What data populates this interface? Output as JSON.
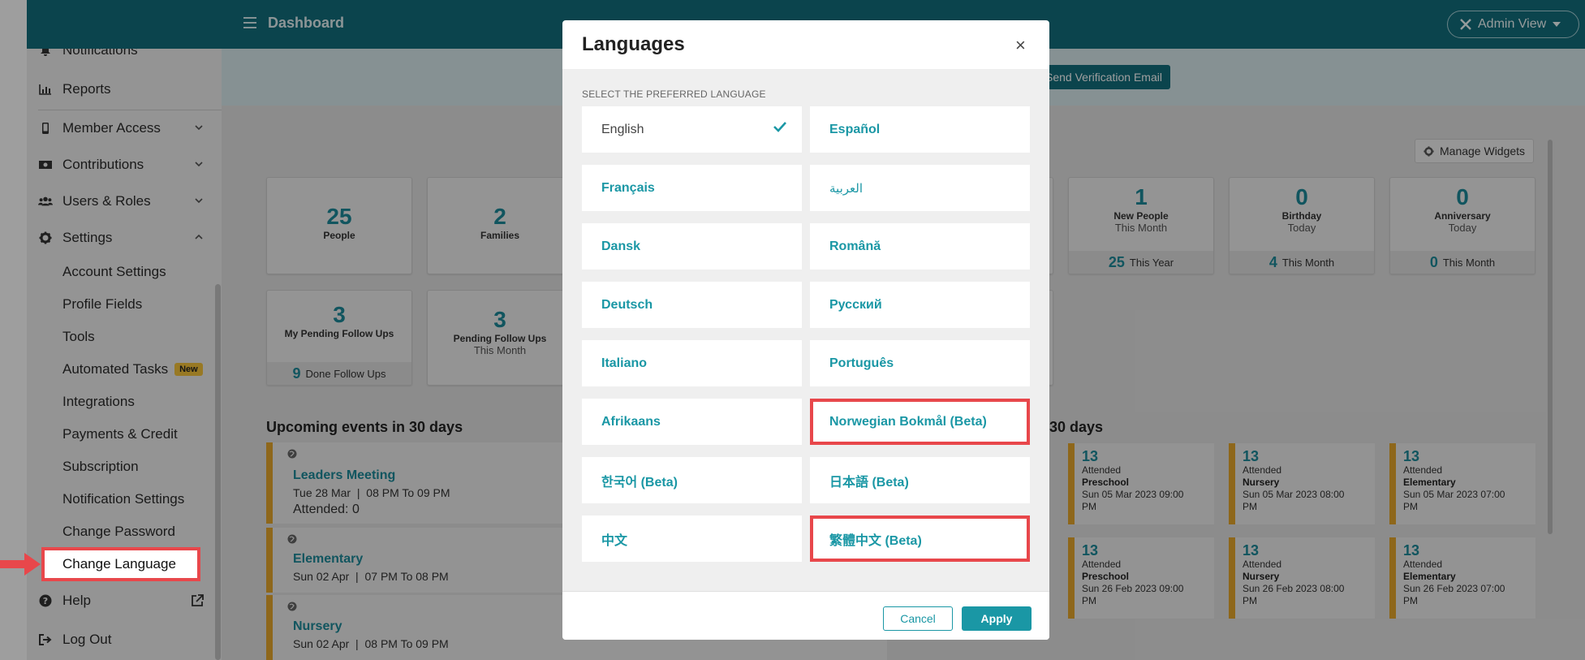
{
  "header": {
    "title": "Dashboard",
    "admin_view": "Admin View"
  },
  "sidebar": {
    "notifications": "Notifications",
    "reports": "Reports",
    "member_access": "Member Access",
    "contributions": "Contributions",
    "users_roles": "Users & Roles",
    "settings": "Settings",
    "settings_items": [
      "Account Settings",
      "Profile Fields",
      "Tools",
      "Automated Tasks",
      "Integrations",
      "Payments & Credit",
      "Subscription",
      "Notification Settings",
      "Change Password",
      "Change Language"
    ],
    "new_badge": "New",
    "help": "Help",
    "logout": "Log Out"
  },
  "main": {
    "verify_button": "Send Verification Email",
    "manage_widgets": "Manage Widgets",
    "stats_row1": [
      {
        "num": "25",
        "label": "People"
      },
      {
        "num": "2",
        "label": "Families"
      },
      {
        "num": "1",
        "label": "New People",
        "sub": "This Month",
        "foot_num": "25",
        "foot_text": "This Year"
      },
      {
        "num": "0",
        "label": "Birthday",
        "sub": "Today",
        "foot_num": "4",
        "foot_text": "This Month"
      },
      {
        "num": "0",
        "label": "Anniversary",
        "sub": "Today",
        "foot_num": "0",
        "foot_text": "This Month"
      }
    ],
    "stats_row2": [
      {
        "num": "3",
        "label": "My Pending Follow Ups",
        "foot_num": "9",
        "foot_text": "Done Follow Ups"
      },
      {
        "num": "3",
        "label": "Pending Follow Ups",
        "sub": "This Month"
      }
    ],
    "events_title": "Upcoming events in 30 days",
    "events": [
      {
        "name": "Leaders Meeting",
        "date": "Tue 28 Mar",
        "time": "08 PM To 09 PM",
        "attended": "Attended: 0"
      },
      {
        "name": "Elementary",
        "date": "Sun 02 Apr",
        "time": "07 PM To 08 PM"
      },
      {
        "name": "Nursery",
        "date": "Sun 02 Apr",
        "time": "08 PM To 09 PM"
      }
    ],
    "attendance_title_fragment": "30 days",
    "attendance": [
      {
        "num": "13",
        "label": "Attended",
        "class": "Preschool",
        "date": "Sun 05 Mar 2023 09:00",
        "ampm": "PM"
      },
      {
        "num": "13",
        "label": "Attended",
        "class": "Nursery",
        "date": "Sun 05 Mar 2023 08:00",
        "ampm": "PM"
      },
      {
        "num": "13",
        "label": "Attended",
        "class": "Elementary",
        "date": "Sun 05 Mar 2023 07:00",
        "ampm": "PM"
      },
      {
        "num": "13",
        "label": "Attended",
        "class": "Preschool",
        "date": "Sun 26 Feb 2023 09:00",
        "ampm": "PM"
      },
      {
        "num": "13",
        "label": "Attended",
        "class": "Nursery",
        "date": "Sun 26 Feb 2023 08:00",
        "ampm": "PM"
      },
      {
        "num": "13",
        "label": "Attended",
        "class": "Elementary",
        "date": "Sun 26 Feb 2023 07:00",
        "ampm": "PM"
      }
    ]
  },
  "modal": {
    "title": "Languages",
    "close": "×",
    "prompt": "SELECT THE PREFERRED LANGUAGE",
    "languages": [
      "English",
      "Español",
      "Français",
      "العربية",
      "Dansk",
      "Română",
      "Deutsch",
      "Русский",
      "Italiano",
      "Português",
      "Afrikaans",
      "Norwegian Bokmål  (Beta)",
      "한국어  (Beta)",
      "日本語  (Beta)",
      "中文",
      "繁體中文  (Beta)"
    ],
    "selected": "English",
    "cancel": "Cancel",
    "apply": "Apply"
  },
  "colors": {
    "header": "#136e7d",
    "accent": "#1a97a5",
    "highlight": "#e8474b",
    "event_bar": "#e5a62c"
  }
}
